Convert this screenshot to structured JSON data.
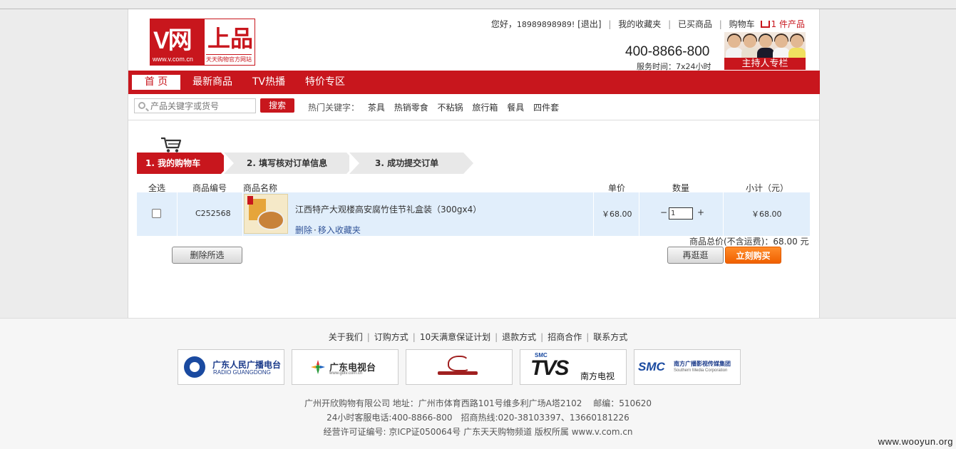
{
  "header": {
    "logo": {
      "left_text": "V网",
      "url": "www.v.com.cn",
      "right_text": "上品",
      "tagline": "天天购物官方网站"
    },
    "greeting": "您好，",
    "user_phone": "18989898989!",
    "logout": "[退出]",
    "links": [
      "我的收藏夹",
      "已买商品",
      "购物车"
    ],
    "cart_count": "1",
    "cart_suffix": "件产品",
    "hotline": "400-8866-800",
    "service_hours": "服务时间：7x24小时",
    "hosts_label": "主持人专栏"
  },
  "nav": {
    "items": [
      "首 页",
      "最新商品",
      "TV热播",
      "特价专区"
    ]
  },
  "search": {
    "placeholder": "产品关键字或货号",
    "button": "搜索",
    "hot_label": "热门关键字：",
    "keywords": [
      "茶具",
      "热销零食",
      "不粘锅",
      "旅行箱",
      "餐具",
      "四件套"
    ]
  },
  "steps": [
    "1. 我的购物车",
    "2. 填写核对订单信息",
    "3. 成功提交订单"
  ],
  "table": {
    "headers": [
      "全选",
      "商品编号",
      "商品名称",
      "单价",
      "数量",
      "小计（元）"
    ],
    "rows": [
      {
        "sku": "C252568",
        "name": "江西特产大观楼高安腐竹佳节礼盒装（300gx4）",
        "delete": "删除",
        "dot": "·",
        "favorite": "移入收藏夹",
        "price": "￥68.00",
        "qty": "1",
        "minus": "−",
        "plus": "+",
        "subtotal": "￥68.00"
      }
    ]
  },
  "summary": {
    "total_text": "商品总价(不含运费)：68.00 元",
    "delete_selected": "删除所选",
    "continue_shopping": "再逛逛",
    "buy_now": "立刻购买"
  },
  "footer": {
    "links": [
      "关于我们",
      "订购方式",
      "10天满意保证计划",
      "退款方式",
      "招商合作",
      "联系方式"
    ],
    "partners": {
      "p1_name": "广东人民广播电台",
      "p1_en": "RADIO GUANGDONG",
      "p2_name": "广东电视台",
      "p2_url": "www.gdtv.com.cn",
      "p4_logo": "TVS",
      "p4_smc": "SMC",
      "p4_name": "南方电视",
      "p5_logo": "SMC",
      "p5_name": "南方广播影视传媒集团",
      "p5_en": "Southern Media Corporation"
    },
    "info_lines": [
      "广州开欣购物有限公司 地址：广州市体育西路101号维多利广场A塔2102　 邮编：510620",
      "24小时客服电话:400-8866-800　招商热线:020-38103397、13660181226",
      "经营许可证编号: 京ICP证050064号 广东天天购物频道 版权所属 www.v.com.cn"
    ],
    "watermark": "www.wooyun.org"
  },
  "colors": {
    "brand_red": "#c8161d",
    "buy_orange": "#f06000",
    "row_blue": "#e1eefb"
  }
}
